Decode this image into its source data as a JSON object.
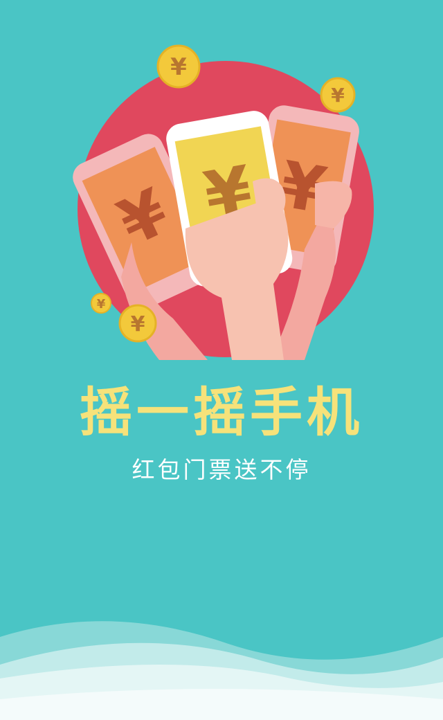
{
  "splash": {
    "title": "摇一摇手机",
    "subtitle": "红包门票送不停"
  },
  "illustration": {
    "coin_symbol": "¥",
    "phone_symbol": "¥"
  },
  "colors": {
    "background": "#4ac5c5",
    "circle": "#e0485e",
    "title": "#f6e27a",
    "subtitle": "#ffffff",
    "coin": "#f3c93b",
    "phone_center": "#f1d553",
    "phone_side": "#ee9157"
  }
}
